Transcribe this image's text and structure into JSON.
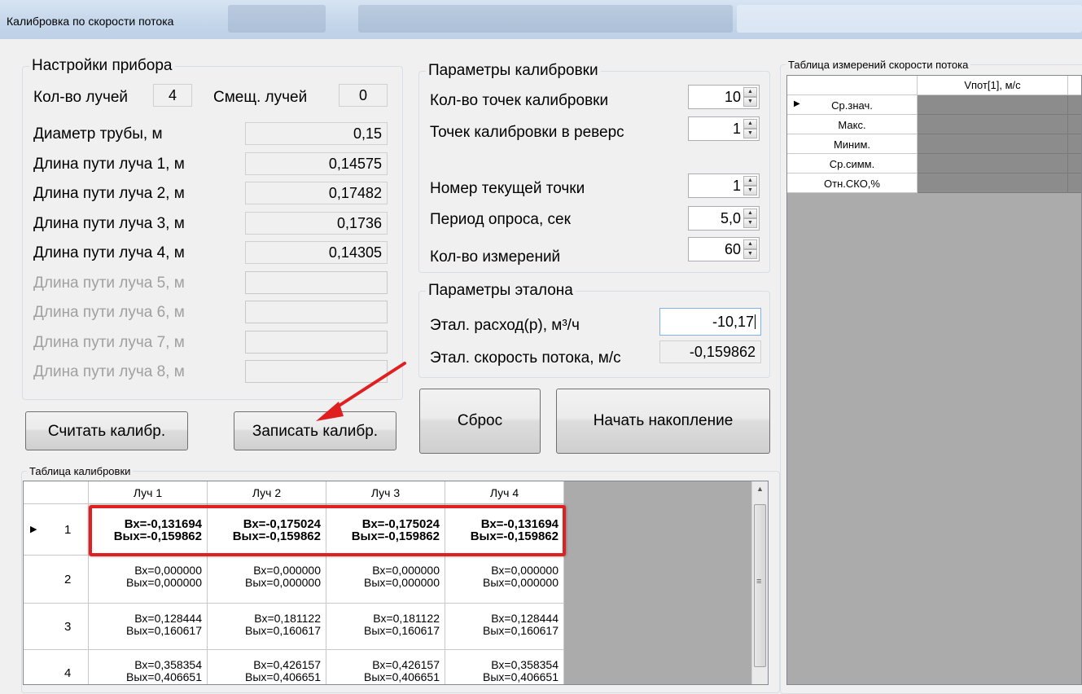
{
  "window": {
    "title": "Калибровка по скорости потока"
  },
  "device_settings": {
    "legend": "Настройки прибора",
    "beam_count_label": "Кол-во лучей",
    "beam_count": "4",
    "beam_offset_label": "Смещ. лучей",
    "beam_offset": "0",
    "fields": [
      {
        "label": "Диаметр трубы, м",
        "value": "0,15",
        "enabled": true
      },
      {
        "label": "Длина пути луча 1, м",
        "value": "0,14575",
        "enabled": true
      },
      {
        "label": "Длина пути луча 2, м",
        "value": "0,17482",
        "enabled": true
      },
      {
        "label": "Длина пути луча 3, м",
        "value": "0,1736",
        "enabled": true
      },
      {
        "label": "Длина пути луча 4, м",
        "value": "0,14305",
        "enabled": true
      },
      {
        "label": "Длина пути луча 5, м",
        "value": "",
        "enabled": false
      },
      {
        "label": "Длина пути луча 6, м",
        "value": "",
        "enabled": false
      },
      {
        "label": "Длина пути луча 7, м",
        "value": "",
        "enabled": false
      },
      {
        "label": "Длина пути луча 8, м",
        "value": "",
        "enabled": false
      }
    ]
  },
  "calibration_params": {
    "legend": "Параметры калибровки",
    "points_label": "Кол-во точек калибровки",
    "points": "10",
    "reverse_label": "Точек калибровки в реверс",
    "reverse": "1",
    "current_label": "Номер текущей точки",
    "current": "1",
    "period_label": "Период опроса, сек",
    "period": "5,0",
    "measurements_label": "Кол-во измерений",
    "measurements": "60"
  },
  "reference_params": {
    "legend": "Параметры эталона",
    "flow_label": "Этал. расход(р), м³/ч",
    "flow": "-10,17",
    "velocity_label": "Этал. скорость потока, м/с",
    "velocity": "-0,159862"
  },
  "buttons": {
    "read": "Считать калибр.",
    "write": "Записать калибр.",
    "reset": "Сброс",
    "start": "Начать накопление"
  },
  "calibration_table": {
    "legend": "Таблица калибровки",
    "columns": [
      "Луч 1",
      "Луч 2",
      "Луч 3",
      "Луч 4"
    ],
    "rows": [
      {
        "num": "1",
        "cells": [
          [
            "Вх=-0,131694",
            "Вых=-0,159862"
          ],
          [
            "Вх=-0,175024",
            "Вых=-0,159862"
          ],
          [
            "Вх=-0,175024",
            "Вых=-0,159862"
          ],
          [
            "Вх=-0,131694",
            "Вых=-0,159862"
          ]
        ]
      },
      {
        "num": "2",
        "cells": [
          [
            "Вх=0,000000",
            "Вых=0,000000"
          ],
          [
            "Вх=0,000000",
            "Вых=0,000000"
          ],
          [
            "Вх=0,000000",
            "Вых=0,000000"
          ],
          [
            "Вх=0,000000",
            "Вых=0,000000"
          ]
        ]
      },
      {
        "num": "3",
        "cells": [
          [
            "Вх=0,128444",
            "Вых=0,160617"
          ],
          [
            "Вх=0,181122",
            "Вых=0,160617"
          ],
          [
            "Вх=0,181122",
            "Вых=0,160617"
          ],
          [
            "Вх=0,128444",
            "Вых=0,160617"
          ]
        ]
      },
      {
        "num": "4",
        "cells": [
          [
            "Вх=0,358354",
            "Вых=0,406651"
          ],
          [
            "Вх=0,426157",
            "Вых=0,406651"
          ],
          [
            "Вх=0,426157",
            "Вых=0,406651"
          ],
          [
            "Вх=0,358354",
            "Вых=0,406651"
          ]
        ]
      }
    ]
  },
  "measurement_table": {
    "legend": "Таблица измерений скорости потока",
    "column": "Vпот[1], м/с",
    "rows": [
      "Ср.знач.",
      "Макс.",
      "Миним.",
      "Ср.симм.",
      "Отн.СКО,%"
    ]
  },
  "colors": {
    "highlight": "#e02020",
    "arrow": "#e02020",
    "empty_cell": "#8c8c8c",
    "focus_border": "#7eb4ea"
  }
}
